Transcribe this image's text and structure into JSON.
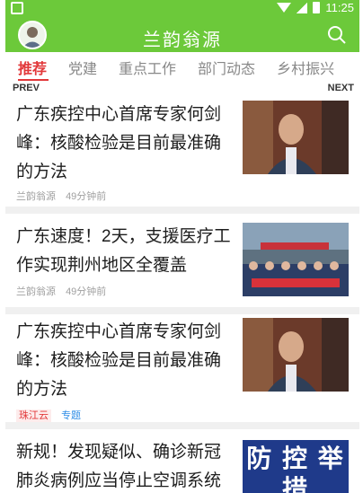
{
  "status": {
    "time": "11:25"
  },
  "app": {
    "title": "兰韵翁源"
  },
  "tabs": [
    "推荐",
    "党建",
    "重点工作",
    "部门动态",
    "乡村振兴"
  ],
  "pager": {
    "prev": "PREV",
    "next": "NEXT"
  },
  "articles": [
    {
      "title": "广东疾控中心首席专家何剑峰：核酸检验是目前最准确的方法",
      "source": "兰韵翁源",
      "time": "49分钟前",
      "thumb": "portrait-icon"
    },
    {
      "title": "广东速度！2天，支援医疗工作实现荆州地区全覆盖",
      "source": "兰韵翁源",
      "time": "49分钟前",
      "thumb": "medical-team-icon"
    },
    {
      "title": "广东疾控中心首席专家何剑峰：核酸检验是目前最准确的方法",
      "tag1": "珠江云",
      "tag2": "专题",
      "thumb": "portrait-icon"
    },
    {
      "title": "新规！发现疑似、确诊新冠肺炎病例应当停止空调系统",
      "thumb_text": "防 控 举 措",
      "thumb": "poster-icon"
    }
  ],
  "colors": {
    "brand": "#6cc93a",
    "accent": "#e2383a",
    "tag_blue": "#2c8ce6"
  }
}
